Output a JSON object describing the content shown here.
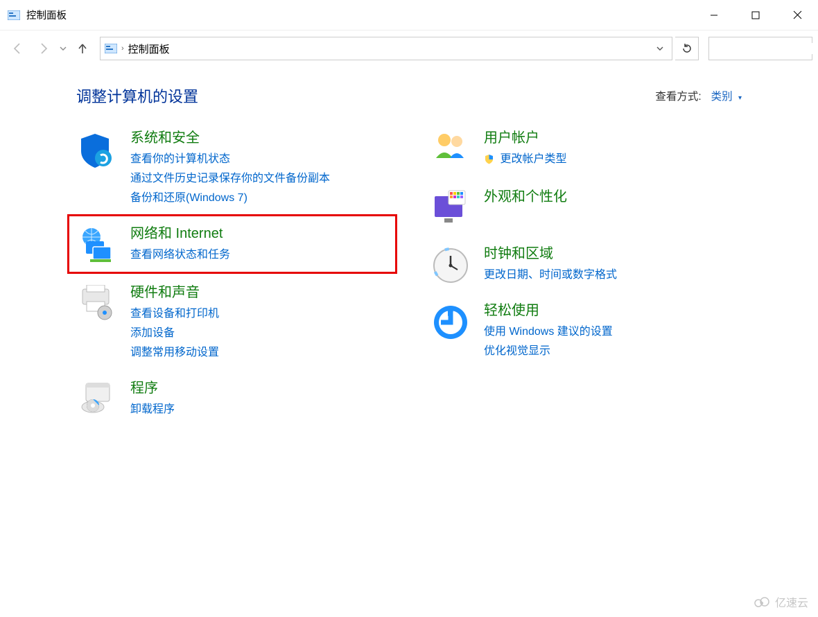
{
  "window": {
    "title": "控制面板"
  },
  "address": {
    "location": "控制面板"
  },
  "search": {
    "placeholder": ""
  },
  "header": {
    "title": "调整计算机的设置",
    "viewby_label": "查看方式:",
    "viewby_value": "类别"
  },
  "categories": {
    "system_security": {
      "title": "系统和安全",
      "links": [
        "查看你的计算机状态",
        "通过文件历史记录保存你的文件备份副本",
        "备份和还原(Windows 7)"
      ]
    },
    "network_internet": {
      "title": "网络和 Internet",
      "links": [
        "查看网络状态和任务"
      ]
    },
    "hardware_sound": {
      "title": "硬件和声音",
      "links": [
        "查看设备和打印机",
        "添加设备",
        "调整常用移动设置"
      ]
    },
    "programs": {
      "title": "程序",
      "links": [
        "卸载程序"
      ]
    },
    "user_accounts": {
      "title": "用户帐户",
      "links": [
        "更改帐户类型"
      ]
    },
    "appearance": {
      "title": "外观和个性化",
      "links": []
    },
    "clock_region": {
      "title": "时钟和区域",
      "links": [
        "更改日期、时间或数字格式"
      ]
    },
    "ease_of_access": {
      "title": "轻松使用",
      "links": [
        "使用 Windows 建议的设置",
        "优化视觉显示"
      ]
    }
  },
  "watermark": "亿速云"
}
